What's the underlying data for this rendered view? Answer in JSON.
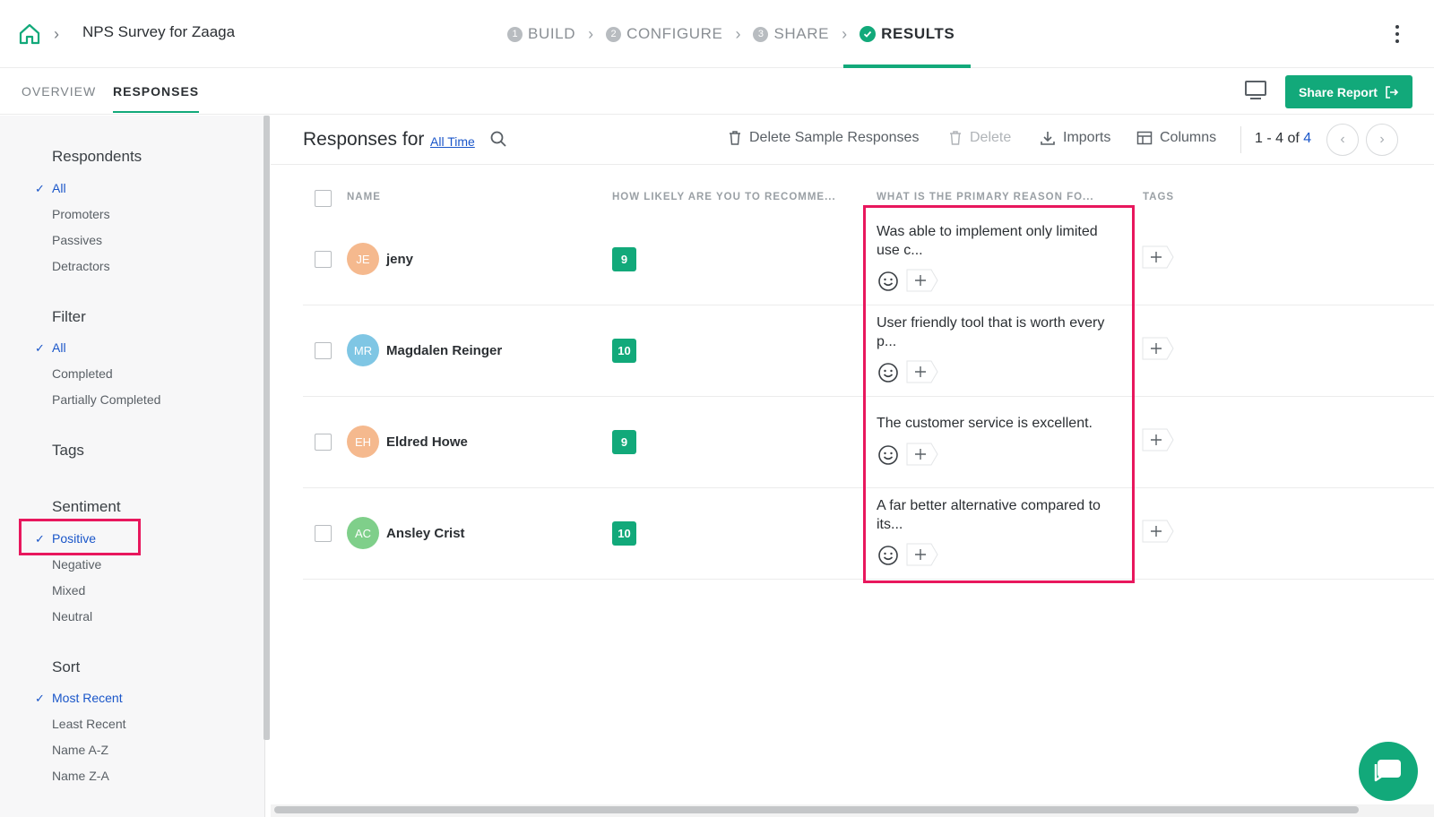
{
  "header": {
    "survey_title": "NPS Survey for Zaaga",
    "steps": [
      {
        "num": "1",
        "label": "BUILD"
      },
      {
        "num": "2",
        "label": "CONFIGURE"
      },
      {
        "num": "3",
        "label": "SHARE"
      },
      {
        "num": "",
        "label": "RESULTS"
      }
    ]
  },
  "subnav": {
    "tabs": [
      "OVERVIEW",
      "RESPONSES"
    ],
    "share_label": "Share Report"
  },
  "sidebar": {
    "respondents": {
      "title": "Respondents",
      "items": [
        "All",
        "Promoters",
        "Passives",
        "Detractors"
      ]
    },
    "filter": {
      "title": "Filter",
      "items": [
        "All",
        "Completed",
        "Partially Completed"
      ]
    },
    "tags": {
      "title": "Tags"
    },
    "sentiment": {
      "title": "Sentiment",
      "items": [
        "Positive",
        "Negative",
        "Mixed",
        "Neutral"
      ]
    },
    "sort": {
      "title": "Sort",
      "items": [
        "Most Recent",
        "Least Recent",
        "Name A-Z",
        "Name Z-A"
      ]
    }
  },
  "toolbar": {
    "title": "Responses for",
    "time_range": "All Time",
    "delete_sample": "Delete Sample Responses",
    "delete": "Delete",
    "imports": "Imports",
    "columns": "Columns",
    "pager_range": "1 - 4 of",
    "pager_total": "4"
  },
  "table": {
    "headers": [
      "NAME",
      "HOW LIKELY ARE YOU TO RECOMME...",
      "WHAT IS THE PRIMARY REASON FO...",
      "TAGS"
    ],
    "rows": [
      {
        "initials": "JE",
        "name": "jeny",
        "score": "9",
        "answer": "Was able to implement only limited use c...",
        "avatar_color": "#f5b98e"
      },
      {
        "initials": "MR",
        "name": "Magdalen Reinger",
        "score": "10",
        "answer": "User friendly tool that is worth every p...",
        "avatar_color": "#7fc6e4"
      },
      {
        "initials": "EH",
        "name": "Eldred Howe",
        "score": "9",
        "answer": "The customer service is excellent.",
        "avatar_color": "#f5b98e"
      },
      {
        "initials": "AC",
        "name": "Ansley Crist",
        "score": "10",
        "answer": "A far better alternative compared to its...",
        "avatar_color": "#7fcf8a"
      }
    ]
  },
  "colors": {
    "accent": "#12a97a",
    "link": "#1a56c9",
    "highlight": "#e8175d"
  }
}
